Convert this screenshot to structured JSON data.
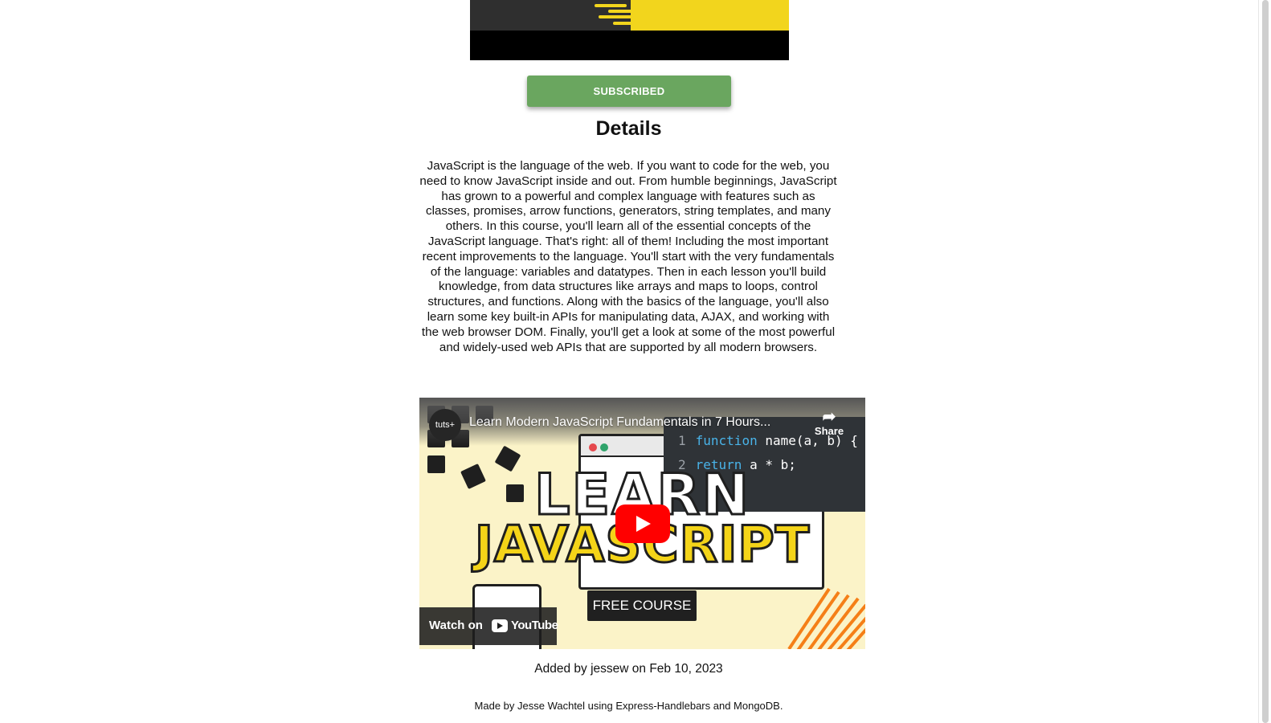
{
  "subscribe_button": {
    "label": "SUBSCRIBED"
  },
  "details": {
    "title": "Details",
    "description": "JavaScript is the language of the web. If you want to code for the web, you need to know JavaScript inside and out. From humble beginnings, JavaScript has grown to a powerful and complex language with features such as classes, promises, arrow functions, generators, string templates, and many others. In this course, you'll learn all of the essential concepts of the JavaScript language. That's right: all of them! Including the most important recent improvements to the language. You'll start with the very fundamentals of the language: variables and datatypes. Then in each lesson you'll build knowledge, from data structures like arrays and maps to loops, control structures, and functions. Along with the basics of the language, you'll also learn some key built-in APIs for manipulating data, AJAX, and working with the web browser DOM. Finally, you'll get a look at some of the most powerful and widely-used web APIs that are supported by all modern browsers."
  },
  "video": {
    "channel": "tuts+",
    "title": "Learn Modern JavaScript Fundamentals in 7 Hours...",
    "share_label": "Share",
    "code_lines": [
      {
        "num": "1",
        "keyword": "function",
        "rest": " name(a, b) {"
      },
      {
        "num": "2",
        "keyword": "return",
        "rest": " a * b;"
      }
    ],
    "thumb_line1": "LEARN",
    "thumb_line2": "JAVASCRIPT",
    "badge": "FREE COURSE",
    "watch_on": "Watch on",
    "youtube": "YouTube"
  },
  "added_by": "Added by jessew on Feb 10, 2023",
  "footer": "Made by Jesse Wachtel using Express-Handlebars and MongoDB.",
  "colors": {
    "subscribe_green": "#6aa65f",
    "banner_yellow": "#f2d51d",
    "youtube_red": "#ff0000"
  }
}
